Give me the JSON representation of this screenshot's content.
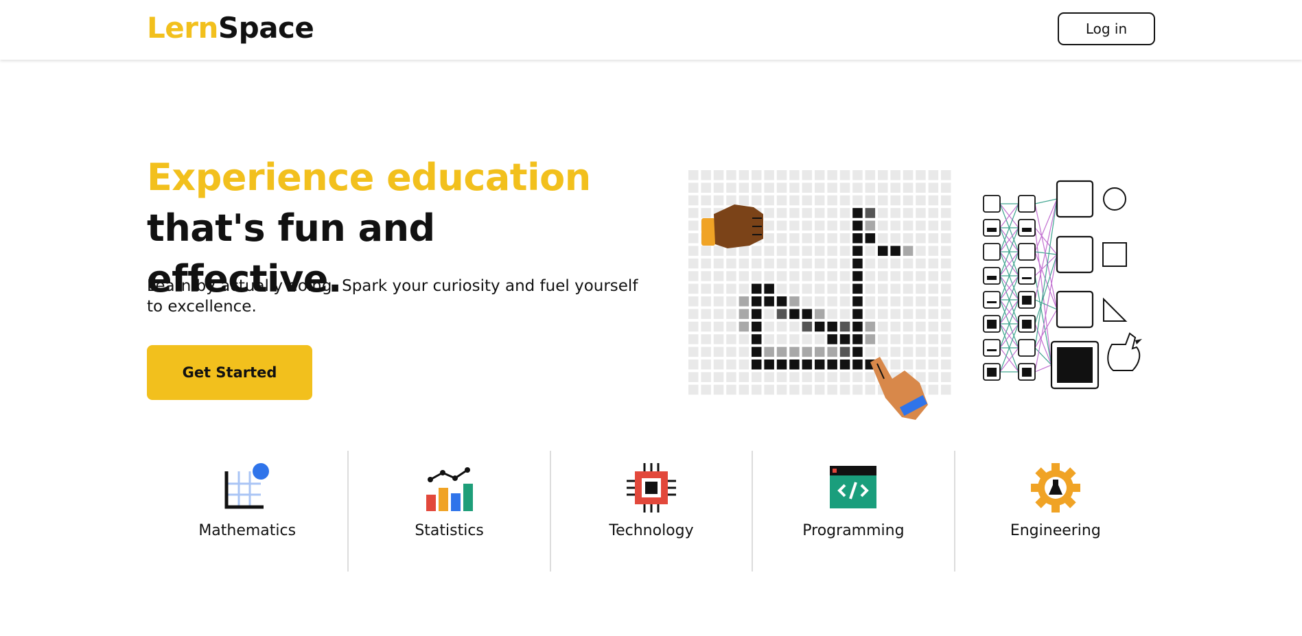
{
  "header": {
    "logo_part1": "Lern",
    "logo_part2": "Space",
    "login_label": "Log in"
  },
  "hero": {
    "headline_highlight": "Experience education",
    "headline_rest": " that's fun and effective.",
    "subtitle": "Learn by actually doing. Spark your curiosity and fuel yourself to excellence.",
    "cta_label": "Get Started"
  },
  "topics": [
    {
      "label": "Mathematics",
      "icon": "grid-chart-icon"
    },
    {
      "label": "Statistics",
      "icon": "bar-chart-icon"
    },
    {
      "label": "Technology",
      "icon": "chip-icon"
    },
    {
      "label": "Programming",
      "icon": "code-window-icon"
    },
    {
      "label": "Engineering",
      "icon": "gear-flask-icon"
    }
  ],
  "colors": {
    "brand_yellow": "#F2C01D",
    "text": "#111111",
    "math_blue": "#2F74EA",
    "stats_red": "#E2483B",
    "stats_green": "#1E9E79",
    "prog_green": "#1A9E7C",
    "eng_orange": "#F0A325"
  }
}
